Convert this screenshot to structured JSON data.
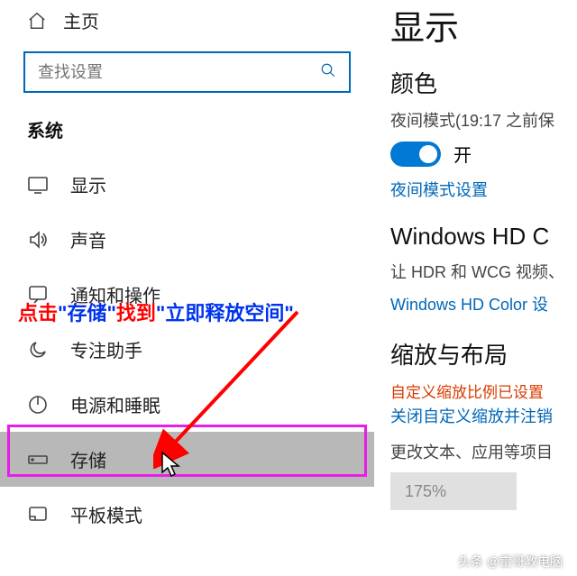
{
  "sidebar": {
    "home_label": "主页",
    "search_placeholder": "查找设置",
    "section_title": "系统",
    "items": [
      {
        "label": "显示"
      },
      {
        "label": "声音"
      },
      {
        "label": "通知和操作"
      },
      {
        "label": "专注助手"
      },
      {
        "label": "电源和睡眠"
      },
      {
        "label": "存储"
      },
      {
        "label": "平板模式"
      }
    ]
  },
  "annotation": {
    "p1": "点击",
    "q1": "\"存储\"",
    "p2": "找到",
    "q2": "\"立即释放空间\""
  },
  "right": {
    "title": "显示",
    "color_heading": "颜色",
    "night_mode_label": "夜间模式(19:17 之前保",
    "toggle_on": "开",
    "night_settings_link": "夜间模式设置",
    "hd_heading": "Windows HD C",
    "hd_desc": "让 HDR 和 WCG 视频、",
    "hd_link": "Windows HD Color 设",
    "scale_heading": "缩放与布局",
    "custom_scale_set": "自定义缩放比例已设置",
    "custom_scale_close": "关闭自定义缩放并注销",
    "change_text": "更改文本、应用等项目",
    "zoom_value": "175%"
  },
  "watermark": "头条 @雷哥教电脑"
}
